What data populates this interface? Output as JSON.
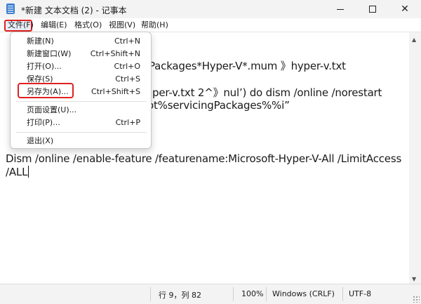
{
  "window": {
    "title": "*新建 文本文档 (2) - 记事本",
    "minimize_glyph": "",
    "maximize_glyph": "",
    "close_glyph": "✕"
  },
  "menubar": {
    "file": "文件(F)",
    "edit": "编辑(E)",
    "format": "格式(O)",
    "view": "视图(V)",
    "help": "帮助(H)"
  },
  "file_menu": {
    "items": [
      {
        "label": "新建(N)",
        "shortcut": "Ctrl+N"
      },
      {
        "label": "新建窗口(W)",
        "shortcut": "Ctrl+Shift+N"
      },
      {
        "label": "打开(O)...",
        "shortcut": "Ctrl+O"
      },
      {
        "label": "保存(S)",
        "shortcut": "Ctrl+S"
      },
      {
        "label": "另存为(A)...",
        "shortcut": "Ctrl+Shift+S"
      },
      {
        "label": "页面设置(U)...",
        "shortcut": ""
      },
      {
        "label": "打印(P)...",
        "shortcut": "Ctrl+P"
      },
      {
        "label": "退出(X)",
        "shortcut": ""
      }
    ]
  },
  "editor": {
    "line1": "Packages*Hyper-V*.mum 》hyper-v.txt",
    "line2": "per-v.txt 2^》nul’) do dism /online /norestart",
    "line3": "ot%servicingPackages%%i”",
    "line4": "Dism /online /enable-feature /featurename:Microsoft-Hyper-V-All /LimitAccess",
    "line5": "/ALL"
  },
  "statusbar": {
    "position": "行 9，列 82",
    "zoom": "100%",
    "line_ending": "Windows (CRLF)",
    "encoding": "UTF-8"
  },
  "colors": {
    "highlight_border": "#e02020",
    "app_icon": "#3d7fcf"
  }
}
